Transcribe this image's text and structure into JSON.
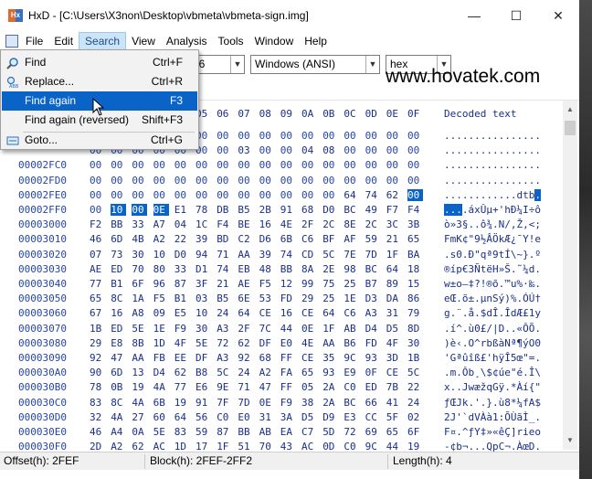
{
  "window": {
    "title": "HxD - [C:\\Users\\X3non\\Desktop\\vbmeta\\vbmeta-sign.img]",
    "minimize": "—",
    "maximize": "☐",
    "close": "✕"
  },
  "menubar": {
    "items": [
      "File",
      "Edit",
      "Search",
      "View",
      "Analysis",
      "Tools",
      "Window",
      "Help"
    ],
    "active": "Search"
  },
  "toolbar": {
    "bytes_per_row": "16",
    "charset": "Windows (ANSI)",
    "offset_base": "hex"
  },
  "watermark": "www.hovatek.com",
  "search_menu": {
    "items": [
      {
        "label": "Find",
        "shortcut": "Ctrl+F",
        "icon": "magnifier-icon"
      },
      {
        "label": "Replace...",
        "shortcut": "Ctrl+R",
        "icon": "replace-icon"
      },
      {
        "label": "Find again",
        "shortcut": "F3",
        "icon": "",
        "highlighted": true
      },
      {
        "label": "Find again (reversed)",
        "shortcut": "Shift+F3",
        "icon": ""
      },
      {
        "label": "Goto...",
        "shortcut": "Ctrl+G",
        "icon": "goto-icon"
      }
    ]
  },
  "editor": {
    "header": {
      "columns_visible": [
        "05",
        "06",
        "07",
        "08",
        "09",
        "0A",
        "0B",
        "0C",
        "0D",
        "0E",
        "0F"
      ],
      "decoded_label": "Decoded text"
    },
    "rows": [
      {
        "offset": "",
        "bytes": [
          "00",
          "00",
          "00",
          "00",
          "00",
          "00",
          "00",
          "00",
          "00",
          "00",
          "00",
          "00",
          "00",
          "00",
          "00",
          "00"
        ],
        "decoded": "................"
      },
      {
        "offset": "",
        "bytes": [
          "00",
          "00",
          "00",
          "00",
          "00",
          "00",
          "00",
          "03",
          "00",
          "00",
          "04",
          "08",
          "00",
          "00",
          "00",
          "00"
        ],
        "decoded": "................"
      },
      {
        "offset": "00002FC0",
        "bytes": [
          "00",
          "00",
          "00",
          "00",
          "00",
          "00",
          "00",
          "00",
          "00",
          "00",
          "00",
          "00",
          "00",
          "00",
          "00",
          "00"
        ],
        "decoded": "................"
      },
      {
        "offset": "00002FD0",
        "bytes": [
          "00",
          "00",
          "00",
          "00",
          "00",
          "00",
          "00",
          "00",
          "00",
          "00",
          "00",
          "00",
          "00",
          "00",
          "00",
          "00"
        ],
        "decoded": "................"
      },
      {
        "offset": "00002FE0",
        "bytes": [
          "00",
          "00",
          "00",
          "00",
          "00",
          "00",
          "00",
          "00",
          "00",
          "00",
          "00",
          "00",
          "64",
          "74",
          "62",
          "00"
        ],
        "decoded": "............dtb."
      },
      {
        "offset": "00002FF0",
        "bytes": [
          "00",
          "10",
          "00",
          "0E",
          "E1",
          "78",
          "DB",
          "B5",
          "2B",
          "91",
          "68",
          "D0",
          "BC",
          "49",
          "F7",
          "F4"
        ],
        "decoded": "....áxÛµ+'hÐ¼I÷ô"
      },
      {
        "offset": "00003000",
        "bytes": [
          "F2",
          "BB",
          "33",
          "A7",
          "04",
          "1C",
          "F4",
          "BE",
          "16",
          "4E",
          "2F",
          "2C",
          "8E",
          "2C",
          "3C",
          "3B"
        ],
        "decoded": "ò»3§..ô¾.N/,Ž,<;"
      },
      {
        "offset": "00003010",
        "bytes": [
          "46",
          "6D",
          "4B",
          "A2",
          "22",
          "39",
          "BD",
          "C2",
          "D6",
          "6B",
          "C6",
          "BF",
          "AF",
          "59",
          "21",
          "65"
        ],
        "decoded": "FmK¢\"9½ÂÖkÆ¿¯Y!e"
      },
      {
        "offset": "00003020",
        "bytes": [
          "07",
          "73",
          "30",
          "10",
          "D0",
          "94",
          "71",
          "AA",
          "39",
          "74",
          "CD",
          "5C",
          "7E",
          "7D",
          "1F",
          "BA"
        ],
        "decoded": ".s0.Ð\"qª9tÍ\\~}.º"
      },
      {
        "offset": "00003030",
        "bytes": [
          "AE",
          "ED",
          "70",
          "80",
          "33",
          "D1",
          "74",
          "EB",
          "48",
          "BB",
          "8A",
          "2E",
          "98",
          "BC",
          "64",
          "18"
        ],
        "decoded": "®íp€3ÑtëH»Š.˜¼d."
      },
      {
        "offset": "00003040",
        "bytes": [
          "77",
          "B1",
          "6F",
          "96",
          "87",
          "3F",
          "21",
          "AE",
          "F5",
          "12",
          "99",
          "75",
          "25",
          "B7",
          "89",
          "15"
        ],
        "decoded": "w±o–‡?!®õ.™u%·‰."
      },
      {
        "offset": "00003050",
        "bytes": [
          "65",
          "8C",
          "1A",
          "F5",
          "B1",
          "03",
          "B5",
          "6E",
          "53",
          "FD",
          "29",
          "25",
          "1E",
          "D3",
          "DA",
          "86"
        ],
        "decoded": "eŒ.õ±.µnSý)%.ÓÚ†"
      },
      {
        "offset": "00003060",
        "bytes": [
          "67",
          "16",
          "A8",
          "09",
          "E5",
          "10",
          "24",
          "64",
          "CE",
          "16",
          "CE",
          "64",
          "C6",
          "A3",
          "31",
          "79"
        ],
        "decoded": "g.¨.å.$dÎ.ÎdÆ£1y"
      },
      {
        "offset": "00003070",
        "bytes": [
          "1B",
          "ED",
          "5E",
          "1E",
          "F9",
          "30",
          "A3",
          "2F",
          "7C",
          "44",
          "0E",
          "1F",
          "AB",
          "D4",
          "D5",
          "8D"
        ],
        "decoded": ".í^.ù0£/|D..«ÔÕ."
      },
      {
        "offset": "00003080",
        "bytes": [
          "29",
          "E8",
          "8B",
          "1D",
          "4F",
          "5E",
          "72",
          "62",
          "DF",
          "E0",
          "4E",
          "AA",
          "B6",
          "FD",
          "4F",
          "30"
        ],
        "decoded": ")è‹.O^rbßàNª¶ýO0"
      },
      {
        "offset": "00003090",
        "bytes": [
          "92",
          "47",
          "AA",
          "FB",
          "EE",
          "DF",
          "A3",
          "92",
          "68",
          "FF",
          "CE",
          "35",
          "9C",
          "93",
          "3D",
          "1B"
        ],
        "decoded": "'Gªûîß£'hÿÎ5œ\"=."
      },
      {
        "offset": "000030A0",
        "bytes": [
          "90",
          "6D",
          "13",
          "D4",
          "62",
          "B8",
          "5C",
          "24",
          "A2",
          "FA",
          "65",
          "93",
          "E9",
          "0F",
          "CE",
          "5C"
        ],
        "decoded": ".m.Ôb¸\\$¢úe\"é.Î\\"
      },
      {
        "offset": "000030B0",
        "bytes": [
          "78",
          "0B",
          "19",
          "4A",
          "77",
          "E6",
          "9E",
          "71",
          "47",
          "FF",
          "05",
          "2A",
          "C0",
          "ED",
          "7B",
          "22"
        ],
        "decoded": "x..JwæžqGÿ.*Àí{\""
      },
      {
        "offset": "000030C0",
        "bytes": [
          "83",
          "8C",
          "4A",
          "6B",
          "19",
          "91",
          "7F",
          "7D",
          "0E",
          "F9",
          "38",
          "2A",
          "BC",
          "66",
          "41",
          "24"
        ],
        "decoded": "ƒŒJk.'.}.ù8*¼fA$"
      },
      {
        "offset": "000030D0",
        "bytes": [
          "32",
          "4A",
          "27",
          "60",
          "64",
          "56",
          "C0",
          "E0",
          "31",
          "3A",
          "D5",
          "D9",
          "E3",
          "CC",
          "5F",
          "02"
        ],
        "decoded": "2J'`dVÀà1:ÕÙãÌ_."
      },
      {
        "offset": "000030E0",
        "bytes": [
          "46",
          "A4",
          "0A",
          "5E",
          "83",
          "59",
          "87",
          "BB",
          "AB",
          "EA",
          "C7",
          "5D",
          "72",
          "69",
          "65",
          "6F"
        ],
        "decoded": "F¤.^ƒY‡»«êÇ]rieo"
      },
      {
        "offset": "000030F0",
        "bytes": [
          "2D",
          "A2",
          "62",
          "AC",
          "1D",
          "17",
          "1F",
          "51",
          "70",
          "43",
          "AC",
          "0D",
          "C0",
          "9C",
          "44",
          "19"
        ],
        "decoded": "-¢b¬...QpC¬.ÀœD."
      }
    ]
  },
  "statusbar": {
    "offset": "Offset(h): 2FEF",
    "block": "Block(h): 2FEF-2FF2",
    "length": "Length(h): 4"
  }
}
